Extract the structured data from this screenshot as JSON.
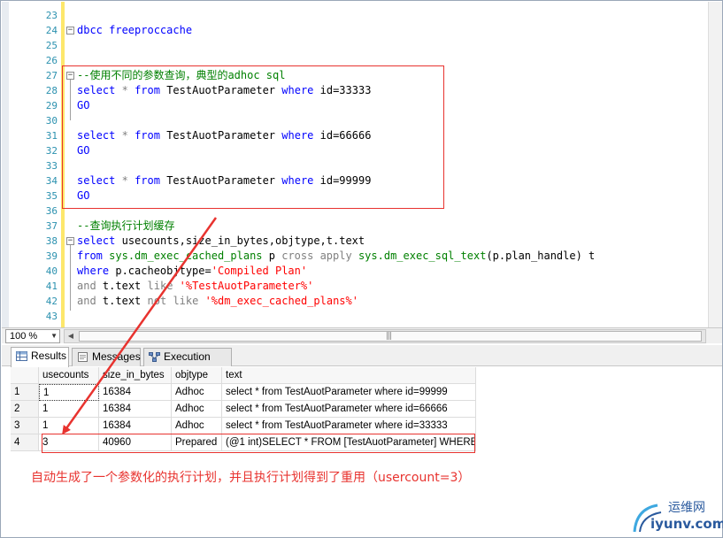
{
  "editor": {
    "line_numbers": [
      "23",
      "24",
      "25",
      "26",
      "27",
      "28",
      "29",
      "30",
      "31",
      "32",
      "33",
      "34",
      "35",
      "36",
      "37",
      "38",
      "39",
      "40",
      "41",
      "42",
      "43"
    ],
    "line24": "dbcc freeproccache",
    "line27_comment": "--使用不同的参数查询，典型的adhoc sql",
    "select_kw": "select",
    "star": "*",
    "from_kw": "from",
    "table_name": "TestAuotParameter",
    "where_kw": "where",
    "cond_33333": "id=33333",
    "cond_66666": "id=66666",
    "cond_99999": "id=99999",
    "go": "GO",
    "line37_comment": "--查询执行计划缓存",
    "line38_cols": "usecounts,size_in_bytes,objtype,t.text",
    "line39_view1": "sys.dm_exec_cached_plans",
    "line39_p": "p",
    "line39_cross": "cross apply",
    "line39_func": "sys.dm_exec_sql_text",
    "line39_args": "(p.plan_handle) t",
    "line40_expr": "p.cacheobjtype=",
    "line40_str": "'Compiled Plan'",
    "and_kw": "and",
    "line41_expr": "t.text",
    "like_kw": "like",
    "line41_str": "'%TestAuotParameter%'",
    "not_kw": "not",
    "line42_str": "'%dm_exec_cached_plans%'"
  },
  "zoom": {
    "value": "100 %"
  },
  "tabs": [
    {
      "label": "Results"
    },
    {
      "label": "Messages"
    },
    {
      "label": "Execution plan"
    }
  ],
  "grid": {
    "columns": [
      "usecounts",
      "size_in_bytes",
      "objtype",
      "text"
    ],
    "rows": [
      {
        "num": "1",
        "usecounts": "1",
        "size": "16384",
        "objtype": "Adhoc",
        "text": "  select * from TestAuotParameter where id=99999"
      },
      {
        "num": "2",
        "usecounts": "1",
        "size": "16384",
        "objtype": "Adhoc",
        "text": "  select * from TestAuotParameter where id=66666"
      },
      {
        "num": "3",
        "usecounts": "1",
        "size": "16384",
        "objtype": "Adhoc",
        "text": "select * from TestAuotParameter where id=33333"
      },
      {
        "num": "4",
        "usecounts": "3",
        "size": "40960",
        "objtype": "Prepared",
        "text": "(@1 int)SELECT * FROM [TestAuotParameter] WHERE..."
      }
    ]
  },
  "annotation": {
    "text": "自动生成了一个参数化的执行计划，并且执行计划得到了重用（usercount=3）",
    "color": "#e8332f"
  },
  "watermark": {
    "top": "运维网",
    "bottom": "iyunv.com"
  }
}
